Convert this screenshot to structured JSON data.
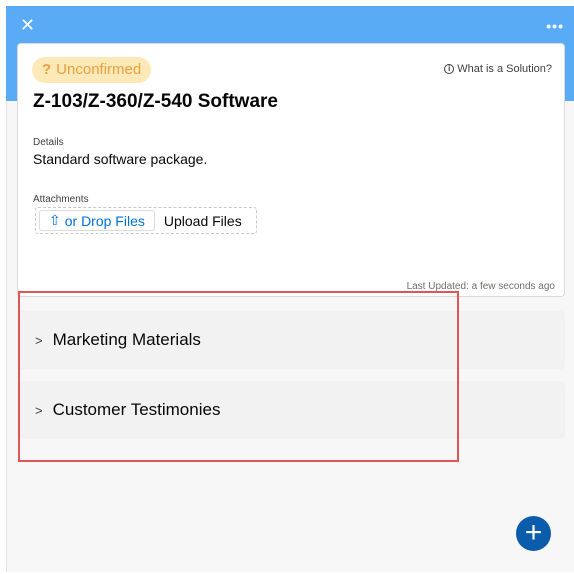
{
  "header": {
    "close_icon_glyph": "✕",
    "more_icon_glyph": "•••"
  },
  "card": {
    "status_badge": "Unconfirmed",
    "status_icon_glyph": "?",
    "help_link": "What is a Solution?",
    "title": "Z-103/Z-360/Z-540 Software",
    "details_label": "Details",
    "details_value": "Standard software package.",
    "attachments_label": "Attachments",
    "upload_button_label": "or Drop Files",
    "upload_files_text": "Upload Files",
    "last_updated": "Last Updated: a few seconds ago"
  },
  "sections": [
    {
      "label": "Marketing Materials"
    },
    {
      "label": "Customer Testimonies"
    }
  ],
  "fab": {
    "glyph": "+"
  },
  "colors": {
    "header_blue": "#5aabf5",
    "badge_bg": "#fde9b8",
    "badge_text": "#e8a13d",
    "link_blue": "#0070d2",
    "highlight_red": "#e05555",
    "fab_blue": "#0b5cab"
  }
}
